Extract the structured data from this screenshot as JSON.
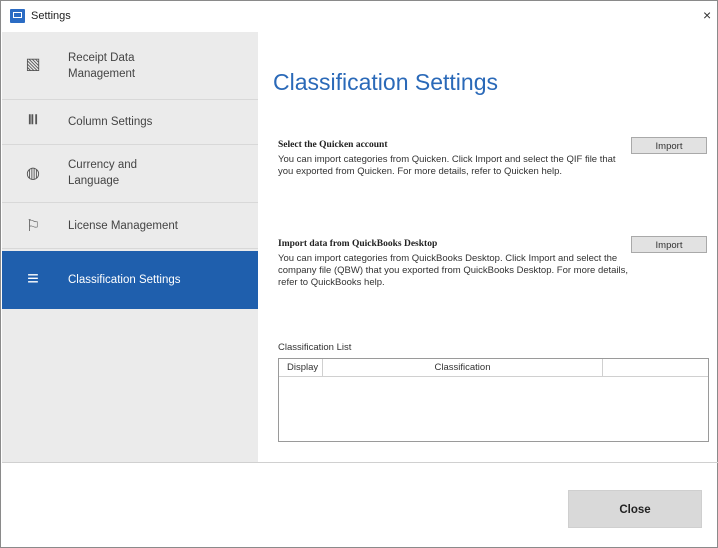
{
  "window": {
    "title": "Settings",
    "close_glyph": "×"
  },
  "sidebar": {
    "items": [
      {
        "label": "Receipt Data Management",
        "icon": "receipt-icon",
        "glyph": "▧"
      },
      {
        "label": "Column Settings",
        "icon": "columns-icon",
        "glyph": "ⅡⅠ"
      },
      {
        "label": "Currency and Language",
        "icon": "globe-icon",
        "glyph": "◍"
      },
      {
        "label": "License Management",
        "icon": "license-icon",
        "glyph": "⚐"
      },
      {
        "label": "Classification Settings",
        "icon": "list-icon",
        "glyph": "≡",
        "active": true
      }
    ]
  },
  "main": {
    "title": "Classification Settings",
    "quicken": {
      "heading": "Select the Quicken account",
      "text": "You can import categories from Quicken. Click Import and select the QIF file that you exported from Quicken. For more details, refer to Quicken help.",
      "button": "Import"
    },
    "quickbooks": {
      "heading": "Import data from QuickBooks Desktop",
      "text": "You can import categories from QuickBooks Desktop. Click Import and select the company file (QBW) that you exported from QuickBooks Desktop. For more details, refer to QuickBooks help.",
      "button": "Import"
    },
    "list": {
      "label": "Classification List",
      "columns": [
        "Display",
        "Classification",
        ""
      ]
    }
  },
  "footer": {
    "close_label": "Close"
  },
  "colors": {
    "accent": "#1f5fad",
    "title": "#2a69b8",
    "sidebar_bg": "#ebebeb"
  }
}
